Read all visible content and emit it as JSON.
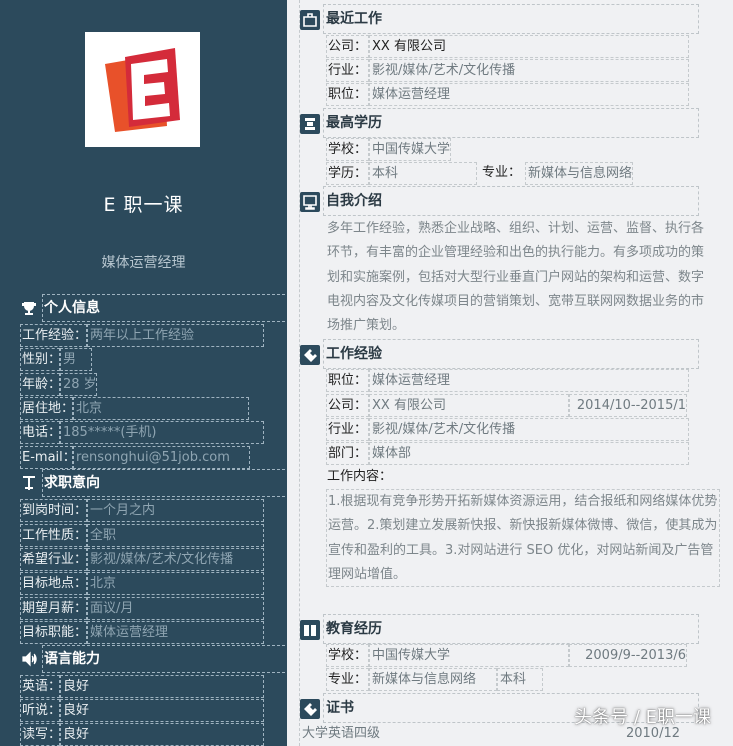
{
  "profile": {
    "name": "E 职一课",
    "role": "媒体运营经理"
  },
  "personal": {
    "title": "个人信息",
    "rows": [
      {
        "k": "工作经验：",
        "v": "两年以上工作经验"
      },
      {
        "k": "性别：",
        "v": "男"
      },
      {
        "k": "年龄：",
        "v": "28 岁"
      },
      {
        "k": "居住地：",
        "v": "北京"
      },
      {
        "k": "电话：",
        "v": "185*****(手机)"
      },
      {
        "k": "E-mail：",
        "v": "rensonghui@51job.com"
      }
    ]
  },
  "intention": {
    "title": "求职意向",
    "rows": [
      {
        "k": "到岗时间：",
        "v": "一个月之内"
      },
      {
        "k": "工作性质：",
        "v": "全职"
      },
      {
        "k": "希望行业：",
        "v": "影视/媒体/艺术/文化传播"
      },
      {
        "k": "目标地点：",
        "v": "北京"
      },
      {
        "k": "期望月薪：",
        "v": "面议/月"
      },
      {
        "k": "目标职能：",
        "v": "媒体运营经理"
      }
    ]
  },
  "language": {
    "title": "语言能力",
    "rows": [
      {
        "k": "英语：",
        "v": "良好"
      },
      {
        "k": "听说：",
        "v": "良好"
      },
      {
        "k": "读写：",
        "v": "良好"
      }
    ]
  },
  "recent": {
    "title": "最近工作",
    "company_k": "公司：",
    "company_v": "XX 有限公司",
    "industry_k": "行业：",
    "industry_v": "影视/媒体/艺术/文化传播",
    "position_k": "职位：",
    "position_v": "媒体运营经理"
  },
  "degree": {
    "title": "最高学历",
    "school_k": "学校：",
    "school_v": "中国传媒大学",
    "edu_k": "学历：",
    "edu_v": "本科",
    "major_k": "专业：",
    "major_v": "新媒体与信息网络"
  },
  "intro": {
    "title": "自我介绍",
    "text": "多年工作经验，熟悉企业战略、组织、计划、运营、监督、执行各环节，有丰富的企业管理经验和出色的执行能力。有多项成功的策划和实施案例，包括对大型行业垂直门户网站的架构和运营、数字电视内容及文化传媒项目的营销策划、宽带互联网网数据业务的市场推广策划。"
  },
  "experience": {
    "title": "工作经验",
    "position_k": "职位：",
    "position_v": "媒体运营经理",
    "company_k": "公司：",
    "company_v": "XX 有限公司",
    "period": "2014/10--2015/1",
    "industry_k": "行业：",
    "industry_v": "影视/媒体/艺术/文化传播",
    "dept_k": "部门：",
    "dept_v": "媒体部",
    "content_label": "工作内容：",
    "content": "1.根据现有竞争形势开拓新媒体资源运用，结合报纸和网络媒体优势运营。2.策划建立发展新快报、新快报新媒体微博、微信，使其成为宣传和盈利的工具。3.对网站进行 SEO 优化，对网站新闻及广告管理网站增值。"
  },
  "education": {
    "title": "教育经历",
    "school_k": "学校：",
    "school_v": "中国传媒大学",
    "period": "2009/9--2013/6",
    "major_k": "专业：",
    "major_v": "新媒体与信息网络",
    "degree_v": "本科"
  },
  "cert": {
    "title": "证书",
    "name": "大学英语四级",
    "date": "2010/12"
  },
  "watermark": "头条号 / E职一课"
}
